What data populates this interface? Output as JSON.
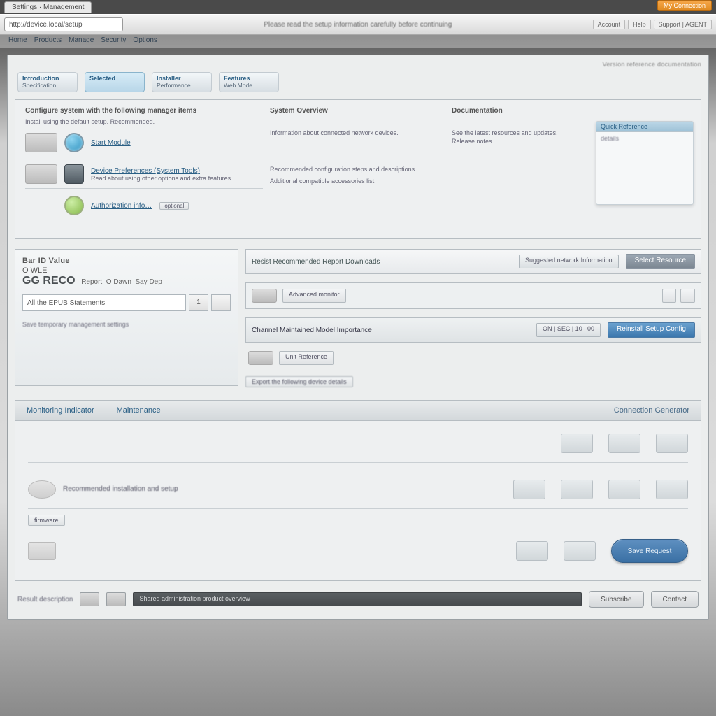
{
  "window": {
    "tab_label": "Settings · Management",
    "orange_btn": "My Connection",
    "address": "http://device.local/setup",
    "banner_title": "Please read the setup information carefully before continuing",
    "right_chip1": "Account",
    "right_chip2": "Help",
    "right_chip3": "Support | AGENT"
  },
  "breadcrumbs": [
    "Home",
    "Products",
    "Manage",
    "Security",
    "Options"
  ],
  "page_meta": "Version reference documentation",
  "tabs": [
    {
      "t1": "Introduction",
      "t2": "Specification"
    },
    {
      "t1": "Selected",
      "t2": ""
    },
    {
      "t1": "Installer",
      "t2": "Performance"
    },
    {
      "t1": "Features",
      "t2": "Web Mode"
    }
  ],
  "panelA": {
    "col1_heading": "Configure system with the following manager items",
    "col1_sub": "Install using the default setup. Recommended.",
    "feat1_title": "Start Module",
    "feat2_title": "Device Preferences (System Tools)",
    "feat2_desc": "Read about using other options and extra features.",
    "feat3_title": "Authorization info…",
    "feat3_badge": "optional",
    "col2_heading": "System Overview",
    "col2_line1": "Information about connected network devices.",
    "col2_line2": "Recommended configuration steps and descriptions.",
    "col2_line3": "Additional compatible accessories list.",
    "col3_heading": "Documentation",
    "col3_line1": "See the latest resources and updates.",
    "col3_line2": "Release notes",
    "right_card_title": "Quick Reference",
    "right_card_body": "details"
  },
  "sidebox": {
    "title": "Bar ID Value",
    "sub": "O WLE",
    "big": "GG RECO",
    "meta1": "Report",
    "meta2": "O Dawn",
    "meta3": "Say Dep",
    "input_value": "All the EPUB Statements",
    "pager": "1",
    "foot": "Save temporary management settings"
  },
  "stripes": {
    "s1_title": "Resist Recommended Report Downloads",
    "s1_chip": "Suggested network Information",
    "s1_btn": "Select Resource",
    "s2_title": "Advanced monitor",
    "s3_title": "Channel Maintained Model Importance",
    "s3_chip": "ON | SEC | 10 | 00",
    "s3_btn": "Reinstall Setup Config",
    "s4_chip": "Unit Reference",
    "below_chip": "Export the following device details"
  },
  "lower": {
    "h1": "Monitoring Indicator",
    "h2": "Maintenance",
    "h3": "Connection Generator",
    "row2_label": "Recommended installation and setup",
    "row2_badge": "firmware",
    "pill": "Save Request"
  },
  "footer": {
    "label": "Result description",
    "bar_text": "Shared administration product overview",
    "btn1": "Subscribe",
    "btn2": "Contact"
  }
}
